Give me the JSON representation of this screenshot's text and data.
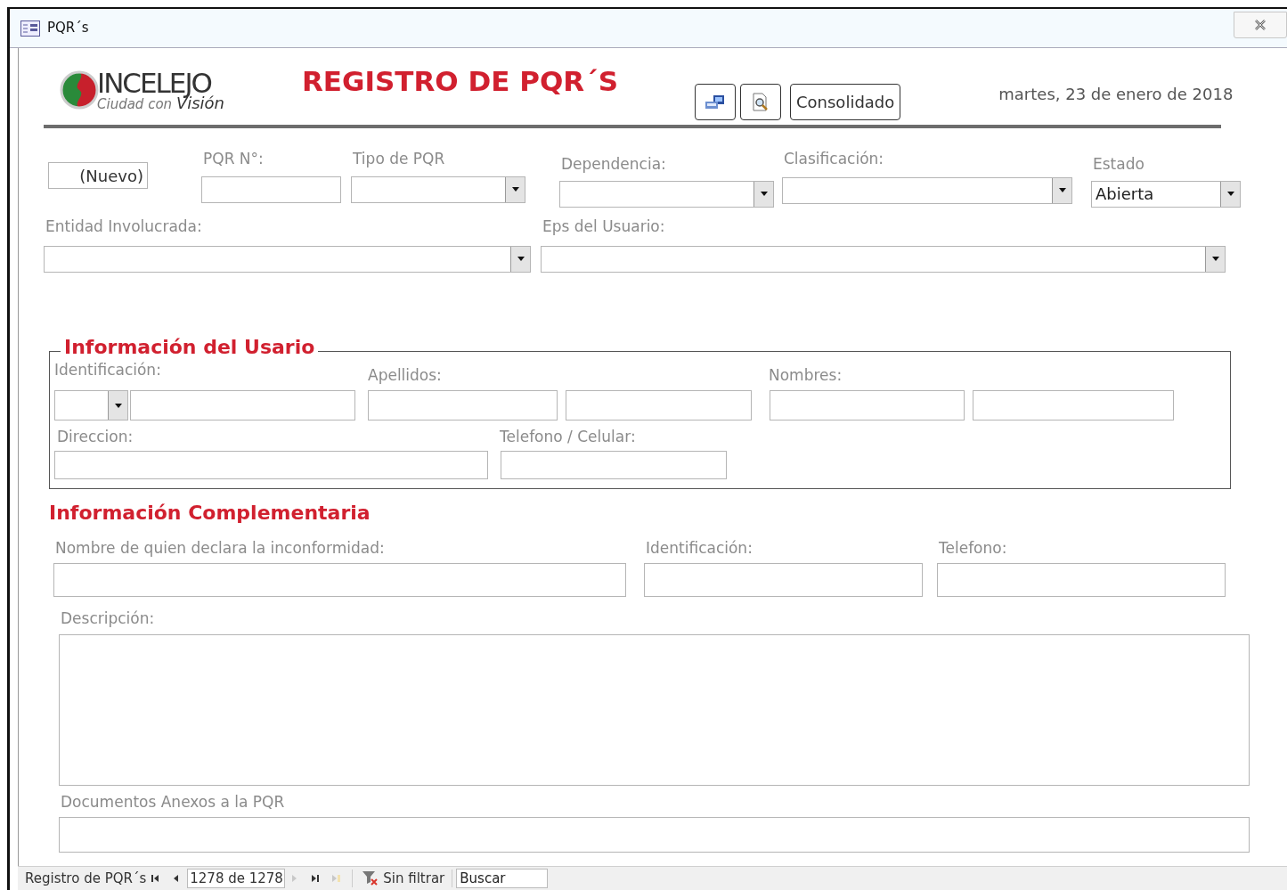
{
  "window": {
    "title": "PQR´s"
  },
  "header": {
    "logo": {
      "name": "INCELEJO",
      "tagline_plain": "Ciudad con",
      "tagline_bold": "Visión"
    },
    "title": "REGISTRO DE PQR´S",
    "buttons": [
      {
        "kind": "save"
      },
      {
        "kind": "preview"
      },
      {
        "kind": "text",
        "label": "Consolidado"
      }
    ],
    "date": "martes, 23 de enero de 2018"
  },
  "record": {
    "value": "(Nuevo)"
  },
  "top_fields": [
    {
      "label": "PQR N°:",
      "kind": "text"
    },
    {
      "label": "Tipo de PQR",
      "kind": "combo"
    },
    {
      "label": "Dependencia:",
      "kind": "combo"
    },
    {
      "label": "Clasificación:",
      "kind": "combo"
    },
    {
      "label": "Estado",
      "kind": "combo",
      "value": "Abierta"
    }
  ],
  "second_fields": [
    {
      "label": "Entidad Involucrada:",
      "kind": "combo"
    },
    {
      "label": "Eps del Usuario:",
      "kind": "combo"
    }
  ],
  "user_section": {
    "title": "Información del Usario",
    "labels": [
      "Identificación:",
      "Apellidos:",
      "Nombres:",
      "Direccion:",
      "Telefono / Celular:"
    ]
  },
  "complementary": {
    "title": "Información Complementaria",
    "fields": [
      {
        "label": "Nombre de quien declara la inconformidad:",
        "kind": "text"
      },
      {
        "label": "Identificación:",
        "kind": "text"
      },
      {
        "label": "Telefono:",
        "kind": "text"
      },
      {
        "label": "Descripción:",
        "kind": "memo"
      },
      {
        "label": "Documentos Anexos a la PQR",
        "kind": "text"
      }
    ]
  },
  "status_bar": {
    "label": "Registro de PQR´s",
    "record": "1278 de 1278",
    "nav": [
      {
        "kind": "first",
        "disabled": false
      },
      {
        "kind": "prev",
        "disabled": false
      },
      {
        "kind": "next",
        "disabled": true
      },
      {
        "kind": "last",
        "disabled": false
      },
      {
        "kind": "new",
        "disabled": true
      }
    ],
    "filter": "Sin filtrar",
    "search": {
      "placeholder": "Buscar"
    }
  }
}
